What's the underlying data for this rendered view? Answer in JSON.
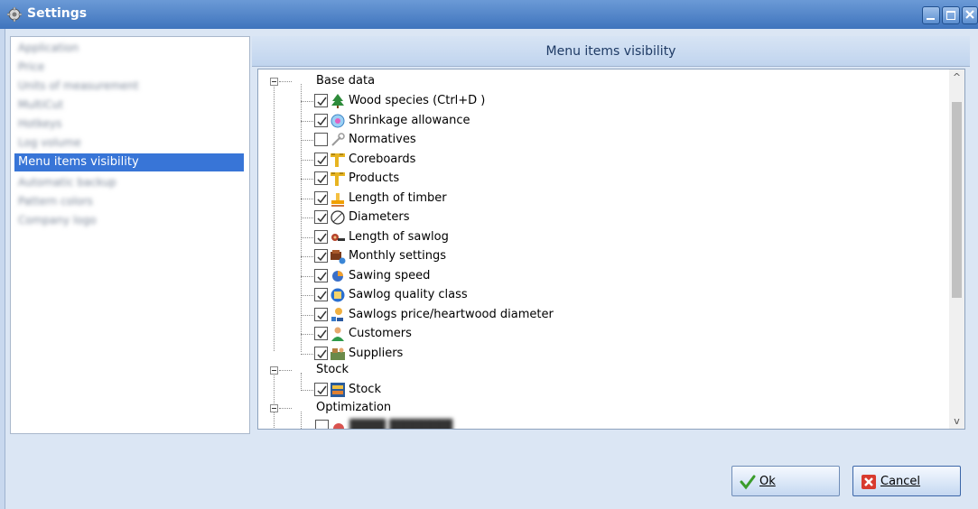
{
  "window": {
    "title": "Settings",
    "colors": {
      "titlebar": "#4a80c8",
      "selection": "#3875d7",
      "panel": "#dbe6f4"
    }
  },
  "sidebar": {
    "items": [
      {
        "label": "Application",
        "blurred": true
      },
      {
        "label": "Price",
        "blurred": true
      },
      {
        "label": "Units of measurement",
        "blurred": true
      },
      {
        "label": "MultiCut",
        "blurred": true
      },
      {
        "label": "Hotkeys",
        "blurred": true
      },
      {
        "label": "Log volume",
        "blurred": true
      },
      {
        "label": "Menu items visibility",
        "selected": true
      },
      {
        "label": "Automatic backup",
        "blurred": true
      },
      {
        "label": "Pattern colors",
        "blurred": true
      },
      {
        "label": "Company logo",
        "blurred": true
      }
    ]
  },
  "main": {
    "header": "Menu items visibility",
    "tree": {
      "groups": [
        {
          "label": "Base data",
          "items": [
            {
              "label": "Wood species (Ctrl+D )",
              "checked": true,
              "icon": "tree-icon"
            },
            {
              "label": "Shrinkage allowance",
              "checked": true,
              "icon": "shrinkage-icon"
            },
            {
              "label": "Normatives",
              "checked": false,
              "icon": "tools-icon"
            },
            {
              "label": "Coreboards",
              "checked": true,
              "icon": "ruler-icon"
            },
            {
              "label": "Products",
              "checked": true,
              "icon": "ruler-icon"
            },
            {
              "label": "Length of timber",
              "checked": true,
              "icon": "timber-length-icon"
            },
            {
              "label": "Diameters",
              "checked": true,
              "icon": "diameter-icon"
            },
            {
              "label": "Length of sawlog",
              "checked": true,
              "icon": "sawlog-icon"
            },
            {
              "label": "Monthly settings",
              "checked": true,
              "icon": "monthly-icon"
            },
            {
              "label": "Sawing speed",
              "checked": true,
              "icon": "pie-icon"
            },
            {
              "label": "Sawlog quality class",
              "checked": true,
              "icon": "quality-icon"
            },
            {
              "label": "Sawlogs price/heartwood diameter",
              "checked": true,
              "icon": "price-icon"
            },
            {
              "label": "Customers",
              "checked": true,
              "icon": "customer-icon"
            },
            {
              "label": "Suppliers",
              "checked": true,
              "icon": "supplier-icon"
            }
          ]
        },
        {
          "label": "Stock",
          "items": [
            {
              "label": "Stock",
              "checked": true,
              "icon": "stock-icon"
            }
          ]
        },
        {
          "label": "Optimization",
          "items": []
        }
      ]
    }
  },
  "buttons": {
    "ok_label": "Ok",
    "cancel_label": "Cancel"
  }
}
